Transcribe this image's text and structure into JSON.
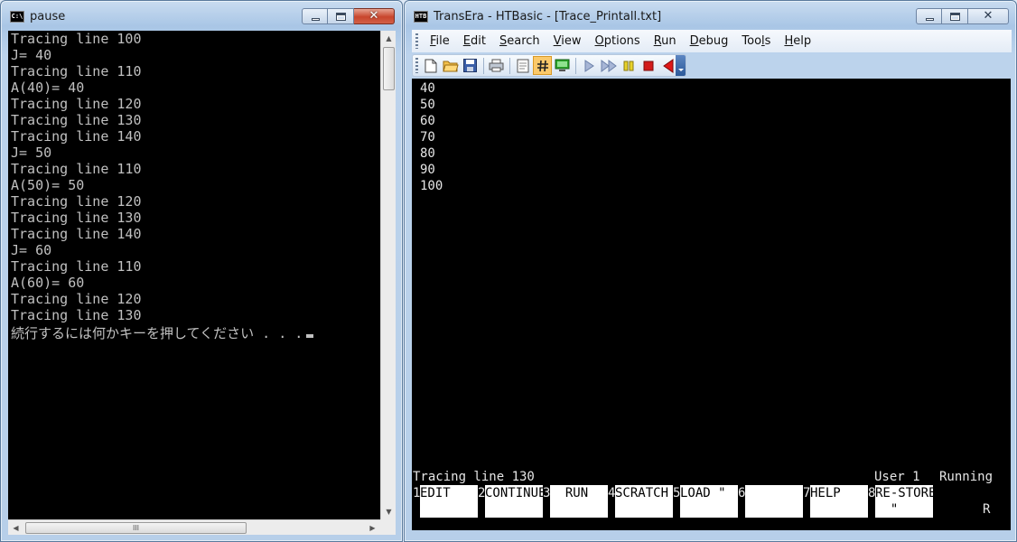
{
  "console_window": {
    "title": "pause",
    "icon_label": "C:\\",
    "lines": [
      "Tracing line 100",
      "J= 40",
      "Tracing line 110",
      "A(40)= 40",
      "Tracing line 120",
      "Tracing line 130",
      "Tracing line 140",
      "J= 50",
      "Tracing line 110",
      "A(50)= 50",
      "Tracing line 120",
      "Tracing line 130",
      "Tracing line 140",
      "J= 60",
      "Tracing line 110",
      "A(60)= 60",
      "Tracing line 120",
      "Tracing line 130"
    ],
    "prompt": "続行するには何かキーを押してください . . .",
    "hscroll_thumb_glyph": "III"
  },
  "htbasic_window": {
    "title": "TransEra - HTBasic - [Trace_Printall.txt]",
    "icon_label": "HTB",
    "menu": [
      {
        "pre": "",
        "u": "F",
        "post": "ile"
      },
      {
        "pre": "",
        "u": "E",
        "post": "dit"
      },
      {
        "pre": "",
        "u": "S",
        "post": "earch"
      },
      {
        "pre": "",
        "u": "V",
        "post": "iew"
      },
      {
        "pre": "",
        "u": "O",
        "post": "ptions"
      },
      {
        "pre": "",
        "u": "R",
        "post": "un"
      },
      {
        "pre": "",
        "u": "D",
        "post": "ebug"
      },
      {
        "pre": "Too",
        "u": "l",
        "post": "s"
      },
      {
        "pre": "",
        "u": "H",
        "post": "elp"
      }
    ],
    "toolbar_icons": [
      "new-file-icon",
      "open-folder-icon",
      "save-icon",
      "print-icon",
      "edit-notes-icon",
      "line-numbers-icon",
      "display-icon",
      "run-icon",
      "step-icon",
      "pause-icon",
      "stop-icon",
      "back-icon"
    ],
    "output_lines": [
      "40",
      "50",
      "60",
      "70",
      "80",
      "90",
      "100"
    ],
    "status": {
      "message": "Tracing line 130",
      "user": "User 1",
      "state": "Running"
    },
    "softkeys": [
      {
        "num": "1",
        "line1": "EDIT",
        "line2": ""
      },
      {
        "num": "2",
        "line1": "CONTINUE",
        "line2": ""
      },
      {
        "num": "3",
        "line1": "  RUN",
        "line2": ""
      },
      {
        "num": "4",
        "line1": "SCRATCH",
        "line2": ""
      },
      {
        "num": "5",
        "line1": "LOAD \"",
        "line2": ""
      },
      {
        "num": "6",
        "line1": "",
        "line2": ""
      },
      {
        "num": "7",
        "line1": "HELP",
        "line2": ""
      },
      {
        "num": "8",
        "line1": "RE-STORE",
        "line2": "  \""
      }
    ],
    "trailing_char": "R"
  },
  "colors": {
    "terminal_bg": "#000000",
    "terminal_text": "#c0c0c0",
    "softkey_bg": "#ffffff",
    "close_button_active": "#c8452c"
  }
}
